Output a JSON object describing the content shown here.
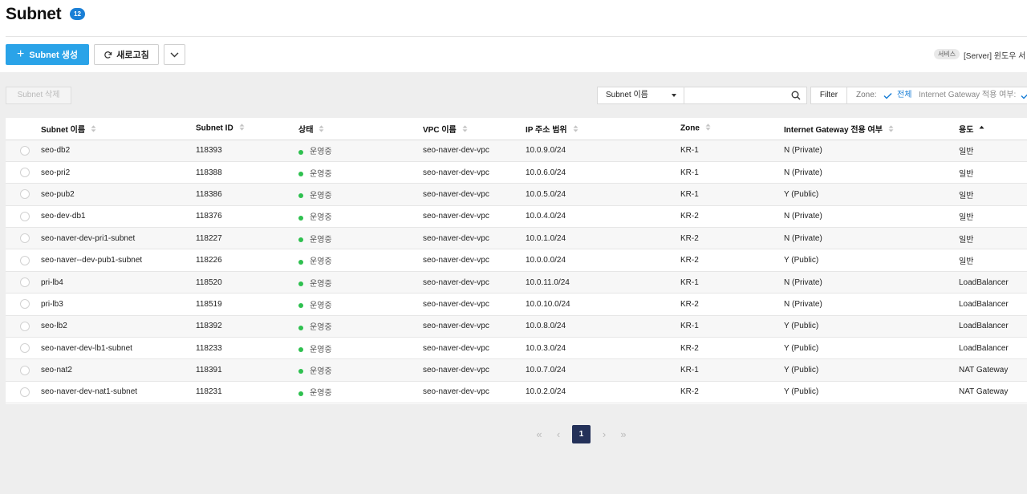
{
  "header": {
    "title": "Subnet",
    "count": "12"
  },
  "toolbar": {
    "create_label": "Subnet 생성",
    "refresh_label": "새로고침",
    "service_chip": "서비스",
    "service_text": "[Server] 윈도우 서"
  },
  "actions": {
    "delete_label": "Subnet 삭제"
  },
  "search": {
    "select_value": "Subnet 이름",
    "query": ""
  },
  "filter": {
    "button_label": "Filter",
    "zone_label": "Zone:",
    "zone_value": "전체",
    "igw_label": "Internet Gateway 적용 여부:"
  },
  "table": {
    "columns": [
      "Subnet 이름",
      "Subnet ID",
      "상태",
      "VPC 이름",
      "IP 주소 범위",
      "Zone",
      "Internet Gateway 전용 여부",
      "용도"
    ],
    "rows": [
      {
        "name": "seo-db2",
        "id": "118393",
        "status": "운영중",
        "vpc": "seo-naver-dev-vpc",
        "ip": "10.0.9.0/24",
        "zone": "KR-1",
        "igw": "N (Private)",
        "usage": "일반"
      },
      {
        "name": "seo-pri2",
        "id": "118388",
        "status": "운영중",
        "vpc": "seo-naver-dev-vpc",
        "ip": "10.0.6.0/24",
        "zone": "KR-1",
        "igw": "N (Private)",
        "usage": "일반"
      },
      {
        "name": "seo-pub2",
        "id": "118386",
        "status": "운영중",
        "vpc": "seo-naver-dev-vpc",
        "ip": "10.0.5.0/24",
        "zone": "KR-1",
        "igw": "Y (Public)",
        "usage": "일반"
      },
      {
        "name": "seo-dev-db1",
        "id": "118376",
        "status": "운영중",
        "vpc": "seo-naver-dev-vpc",
        "ip": "10.0.4.0/24",
        "zone": "KR-2",
        "igw": "N (Private)",
        "usage": "일반"
      },
      {
        "name": "seo-naver-dev-pri1-subnet",
        "id": "118227",
        "status": "운영중",
        "vpc": "seo-naver-dev-vpc",
        "ip": "10.0.1.0/24",
        "zone": "KR-2",
        "igw": "N (Private)",
        "usage": "일반"
      },
      {
        "name": "seo-naver--dev-pub1-subnet",
        "id": "118226",
        "status": "운영중",
        "vpc": "seo-naver-dev-vpc",
        "ip": "10.0.0.0/24",
        "zone": "KR-2",
        "igw": "Y (Public)",
        "usage": "일반"
      },
      {
        "name": "pri-lb4",
        "id": "118520",
        "status": "운영중",
        "vpc": "seo-naver-dev-vpc",
        "ip": "10.0.11.0/24",
        "zone": "KR-1",
        "igw": "N (Private)",
        "usage": "LoadBalancer"
      },
      {
        "name": "pri-lb3",
        "id": "118519",
        "status": "운영중",
        "vpc": "seo-naver-dev-vpc",
        "ip": "10.0.10.0/24",
        "zone": "KR-2",
        "igw": "N (Private)",
        "usage": "LoadBalancer"
      },
      {
        "name": "seo-lb2",
        "id": "118392",
        "status": "운영중",
        "vpc": "seo-naver-dev-vpc",
        "ip": "10.0.8.0/24",
        "zone": "KR-1",
        "igw": "Y (Public)",
        "usage": "LoadBalancer"
      },
      {
        "name": "seo-naver-dev-lb1-subnet",
        "id": "118233",
        "status": "운영중",
        "vpc": "seo-naver-dev-vpc",
        "ip": "10.0.3.0/24",
        "zone": "KR-2",
        "igw": "Y (Public)",
        "usage": "LoadBalancer"
      },
      {
        "name": "seo-nat2",
        "id": "118391",
        "status": "운영중",
        "vpc": "seo-naver-dev-vpc",
        "ip": "10.0.7.0/24",
        "zone": "KR-1",
        "igw": "Y (Public)",
        "usage": "NAT Gateway"
      },
      {
        "name": "seo-naver-dev-nat1-subnet",
        "id": "118231",
        "status": "운영중",
        "vpc": "seo-naver-dev-vpc",
        "ip": "10.0.2.0/24",
        "zone": "KR-2",
        "igw": "Y (Public)",
        "usage": "NAT Gateway"
      }
    ]
  },
  "pagination": {
    "current": "1"
  },
  "colors": {
    "accent": "#2aa3e8",
    "badge": "#1a7fd6",
    "status_running": "#2ec04f",
    "page_active": "#243159"
  },
  "icons": [
    "plus-icon",
    "refresh-icon",
    "chevron-down-icon",
    "search-icon",
    "check-icon",
    "sort-icon",
    "first-page-icon",
    "prev-page-icon",
    "next-page-icon",
    "last-page-icon"
  ]
}
